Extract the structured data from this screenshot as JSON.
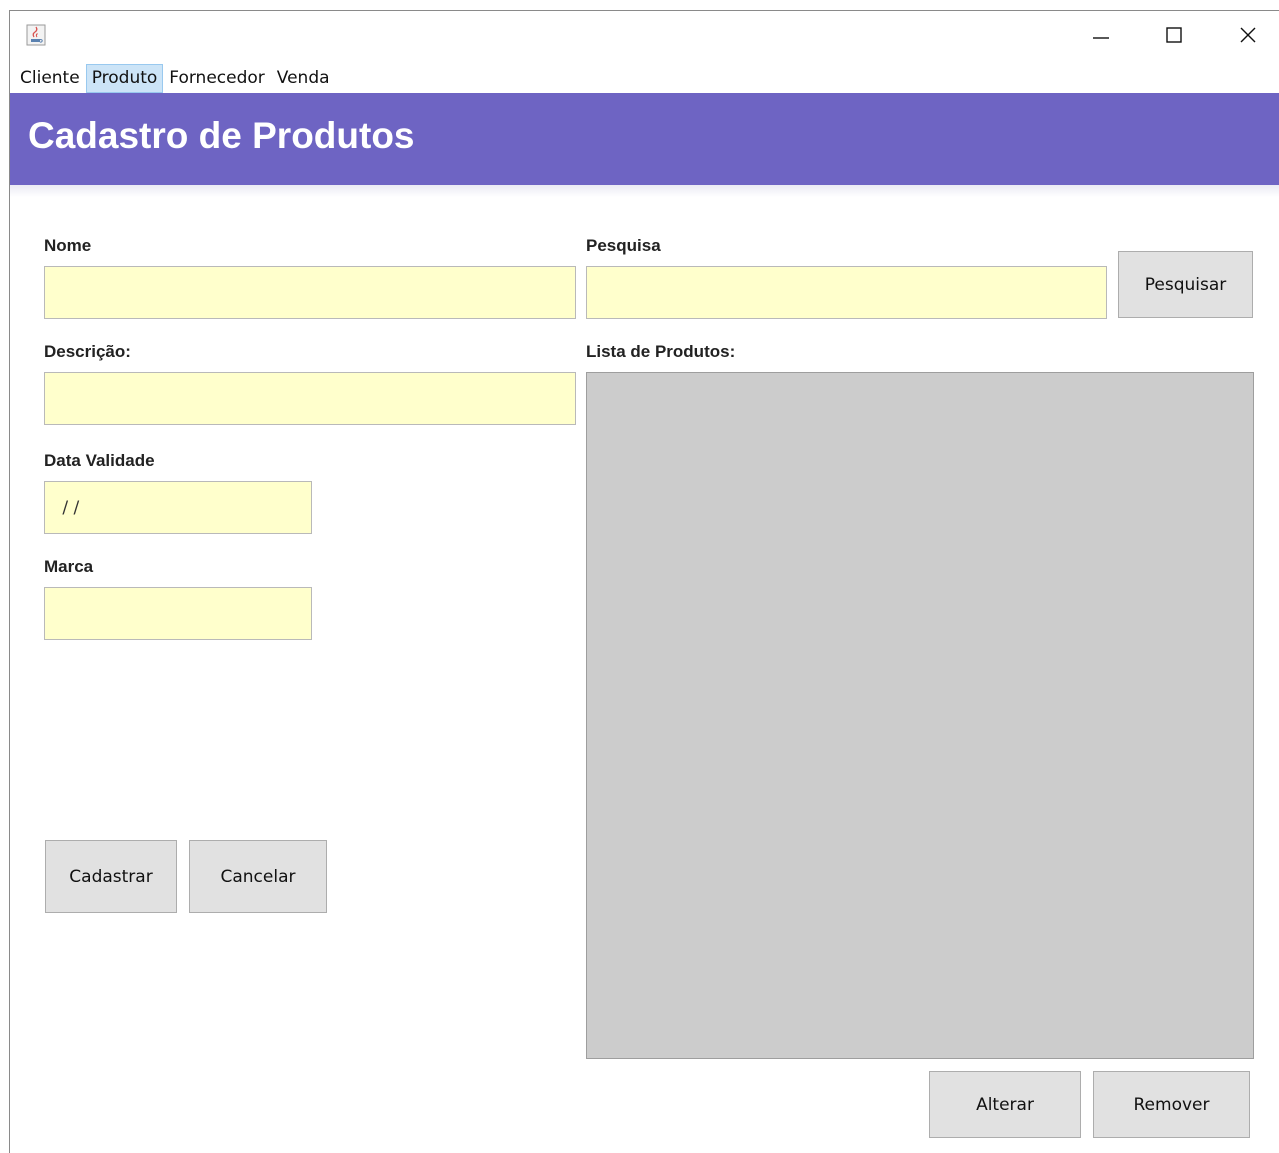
{
  "window": {
    "icons": {
      "app": "java-cup-icon",
      "minimize": "minimize-icon",
      "maximize": "maximize-icon",
      "close": "close-icon"
    }
  },
  "menu": {
    "items": [
      {
        "label": "Cliente",
        "active": false
      },
      {
        "label": "Produto",
        "active": true
      },
      {
        "label": "Fornecedor",
        "active": false
      },
      {
        "label": "Venda",
        "active": false
      }
    ]
  },
  "header": {
    "title": "Cadastro de Produtos",
    "color": "#6e64c3"
  },
  "form": {
    "nome_label": "Nome",
    "nome_value": "",
    "descricao_label": "Descrição:",
    "descricao_value": "",
    "validade_label": "Data Validade",
    "validade_value": " / /",
    "marca_label": "Marca",
    "marca_value": "",
    "cadastrar_label": "Cadastrar",
    "cancelar_label": "Cancelar",
    "field_color": "#ffffcc"
  },
  "search": {
    "label": "Pesquisa",
    "value": "",
    "button_label": "Pesquisar"
  },
  "list": {
    "label": "Lista de Produtos:",
    "items": [],
    "alterar_label": "Alterar",
    "remover_label": "Remover"
  }
}
